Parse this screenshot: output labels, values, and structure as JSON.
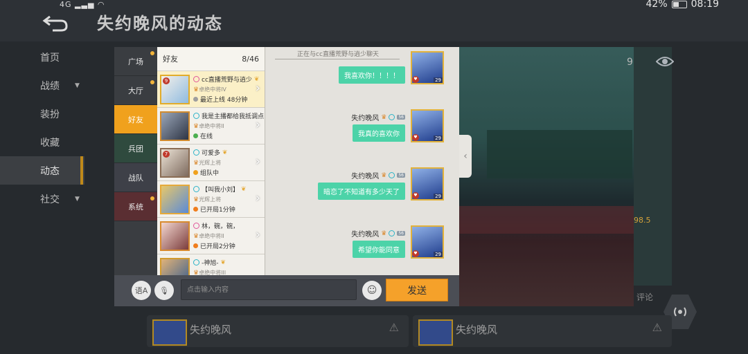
{
  "status_bar": {
    "signal": "4G",
    "battery": "42%",
    "time": "08:19"
  },
  "header": {
    "title": "失约晚风的动态",
    "back_icon": "back-arrow-icon"
  },
  "side_nav": {
    "items": [
      {
        "label": "首页"
      },
      {
        "label": "战绩",
        "caret": "▼"
      },
      {
        "label": "装扮"
      },
      {
        "label": "收藏"
      },
      {
        "label": "动态",
        "active": true
      },
      {
        "label": "社交",
        "caret": "▼"
      }
    ]
  },
  "background": {
    "count_fragment": "9",
    "score_fragment": "98.5",
    "comment": "评论",
    "posts": [
      {
        "name": "失约晚风",
        "warn": "⚠"
      },
      {
        "name": "失约晚风",
        "warn": "⚠"
      }
    ]
  },
  "dialog": {
    "tabs": [
      {
        "label": "广场",
        "dot": true
      },
      {
        "label": "大厅",
        "dot": true
      },
      {
        "label": "好友",
        "active": true
      },
      {
        "label": "兵团"
      },
      {
        "label": "战队"
      },
      {
        "label": "系统",
        "dot": true
      }
    ],
    "friend_list": {
      "title": "好友",
      "count": "8/46",
      "friends": [
        {
          "name": "cc直播荒野与逍少",
          "rank": "卓绝中将IV",
          "status": "最近上线 48分钟",
          "status_color": "#9e9e9e",
          "level": "9"
        },
        {
          "name": "我是主播都给我抵调点",
          "rank": "卓绝中将II",
          "status": "在线",
          "status_color": "#4caf50",
          "level": ""
        },
        {
          "name": "可爱多",
          "rank": "光辉上将",
          "status": "组队中",
          "status_color": "#f0a11d",
          "level": "7"
        },
        {
          "name": "【叫我小刘】",
          "rank": "光辉上将",
          "status": "已开局1分钟",
          "status_color": "#f07d1d",
          "level": ""
        },
        {
          "name": "林，碗，碗，",
          "rank": "卓绝中将II",
          "status": "已开局2分钟",
          "status_color": "#f07d1d",
          "level": ""
        },
        {
          "name": "-神旭-",
          "rank": "卓绝中将III",
          "status": "",
          "status_color": "#9e9e9e",
          "level": ""
        }
      ]
    },
    "chat": {
      "title": "正在与cc直播荒野与逍少聊天",
      "messages": [
        {
          "sender": "失约晚风",
          "text": "我喜欢你！！！！",
          "level": "29",
          "badge": "56"
        },
        {
          "sender": "失约晚风",
          "text": "我真的喜欢你",
          "level": "29",
          "badge": "56"
        },
        {
          "sender": "失约晚风",
          "text": "暗恋了不知道有多少天了",
          "level": "29",
          "badge": "56"
        },
        {
          "sender": "失约晚风",
          "text": "希望你能同意",
          "level": "29",
          "badge": "56"
        }
      ]
    },
    "input": {
      "placeholder": "点击输入内容",
      "send_label": "发送",
      "voice_labels": [
        "语A",
        "语"
      ]
    }
  },
  "colors": {
    "accent": "#f0a11d",
    "bubble": "#4cd3a8",
    "send": "#f5a12a"
  }
}
